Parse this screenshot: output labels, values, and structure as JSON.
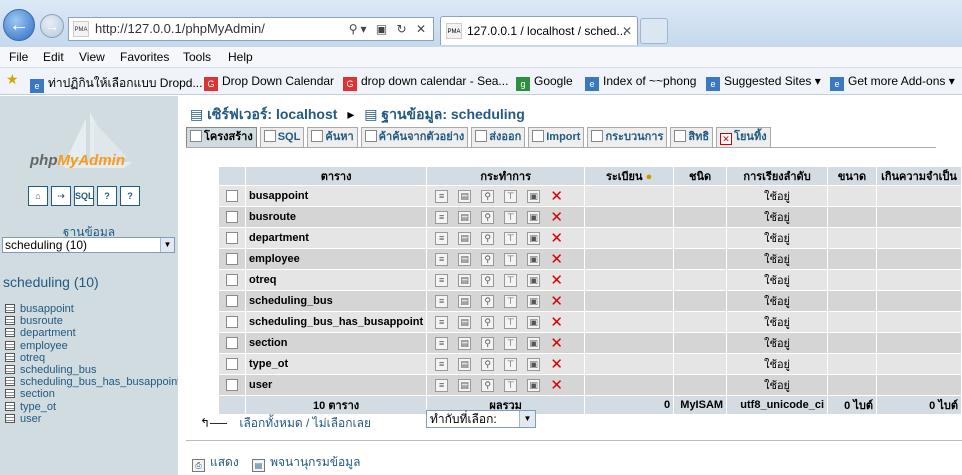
{
  "browser": {
    "address": "http://127.0.0.1/phpMyAdmin/",
    "tab_title": "127.0.0.1 / localhost / sched...",
    "favicon_text": "PMA",
    "menu": [
      "File",
      "Edit",
      "View",
      "Favorites",
      "Tools",
      "Help"
    ],
    "favorites": [
      {
        "label": "ท่าปฏิกินให้เลือกแบบ Dropd...",
        "icon": "ie-page-icon"
      },
      {
        "label": "Drop Down Calendar",
        "icon": "google-g-icon"
      },
      {
        "label": "drop down calendar - Sea...",
        "icon": "google-g-icon"
      },
      {
        "label": "Google",
        "icon": "google-multicolor-icon"
      },
      {
        "label": "Index of ~~phong",
        "icon": "ie-page-icon"
      },
      {
        "label": "Suggested Sites ▾",
        "icon": "ie-page-icon"
      },
      {
        "label": "Get more Add-ons ▾",
        "icon": "ie-page-icon"
      }
    ]
  },
  "sidebar": {
    "logo": {
      "php": "php",
      "myadmin": "MyAdmin"
    },
    "db_label": "ฐานข้อมูล",
    "db_select": "scheduling (10)",
    "db_title": "scheduling (10)",
    "tables": [
      "busappoint",
      "busroute",
      "department",
      "employee",
      "otreq",
      "scheduling_bus",
      "scheduling_bus_has_busappoint",
      "section",
      "type_ot",
      "user"
    ]
  },
  "breadcrumb": {
    "server": "เซิร์ฟเวอร์: localhost",
    "database": "ฐานข้อมูล: scheduling"
  },
  "tabs": [
    "โครงสร้าง",
    "SQL",
    "ค้นหา",
    "ค้าค้นจากตัวอย่าง",
    "ส่งออก",
    "Import",
    "กระบวนการ",
    "สิทธิ",
    "โยนทิ้ง"
  ],
  "table_headers": {
    "table": "ตาราง",
    "action": "กระทำการ",
    "rows": "ระเบียน",
    "type": "ชนิด",
    "collation": "การเรียงลำดับ",
    "size": "ขนาด",
    "overhead": "เกินความจำเป็น"
  },
  "rows": [
    {
      "name": "busappoint",
      "collation": "ใช้อยู่"
    },
    {
      "name": "busroute",
      "collation": "ใช้อยู่"
    },
    {
      "name": "department",
      "collation": "ใช้อยู่"
    },
    {
      "name": "employee",
      "collation": "ใช้อยู่"
    },
    {
      "name": "otreq",
      "collation": "ใช้อยู่"
    },
    {
      "name": "scheduling_bus",
      "collation": "ใช้อยู่"
    },
    {
      "name": "scheduling_bus_has_busappoint",
      "collation": "ใช้อยู่"
    },
    {
      "name": "section",
      "collation": "ใช้อยู่"
    },
    {
      "name": "type_ot",
      "collation": "ใช้อยู่"
    },
    {
      "name": "user",
      "collation": "ใช้อยู่"
    }
  ],
  "footer": {
    "count": "10 ตาราง",
    "sum": "ผลรวม",
    "rows": "0",
    "engine": "MyISAM",
    "collation": "utf8_unicode_ci",
    "size": "0 ไบต์",
    "overhead": "0 ไบต์"
  },
  "check_all": "เลือกทั้งหมด / ไม่เลือกเลย",
  "with_selected": "ทำกับที่เลือก:",
  "bottom_links": {
    "print": "แสดง",
    "dictionary": "พจนานุกรมข้อมูล"
  }
}
